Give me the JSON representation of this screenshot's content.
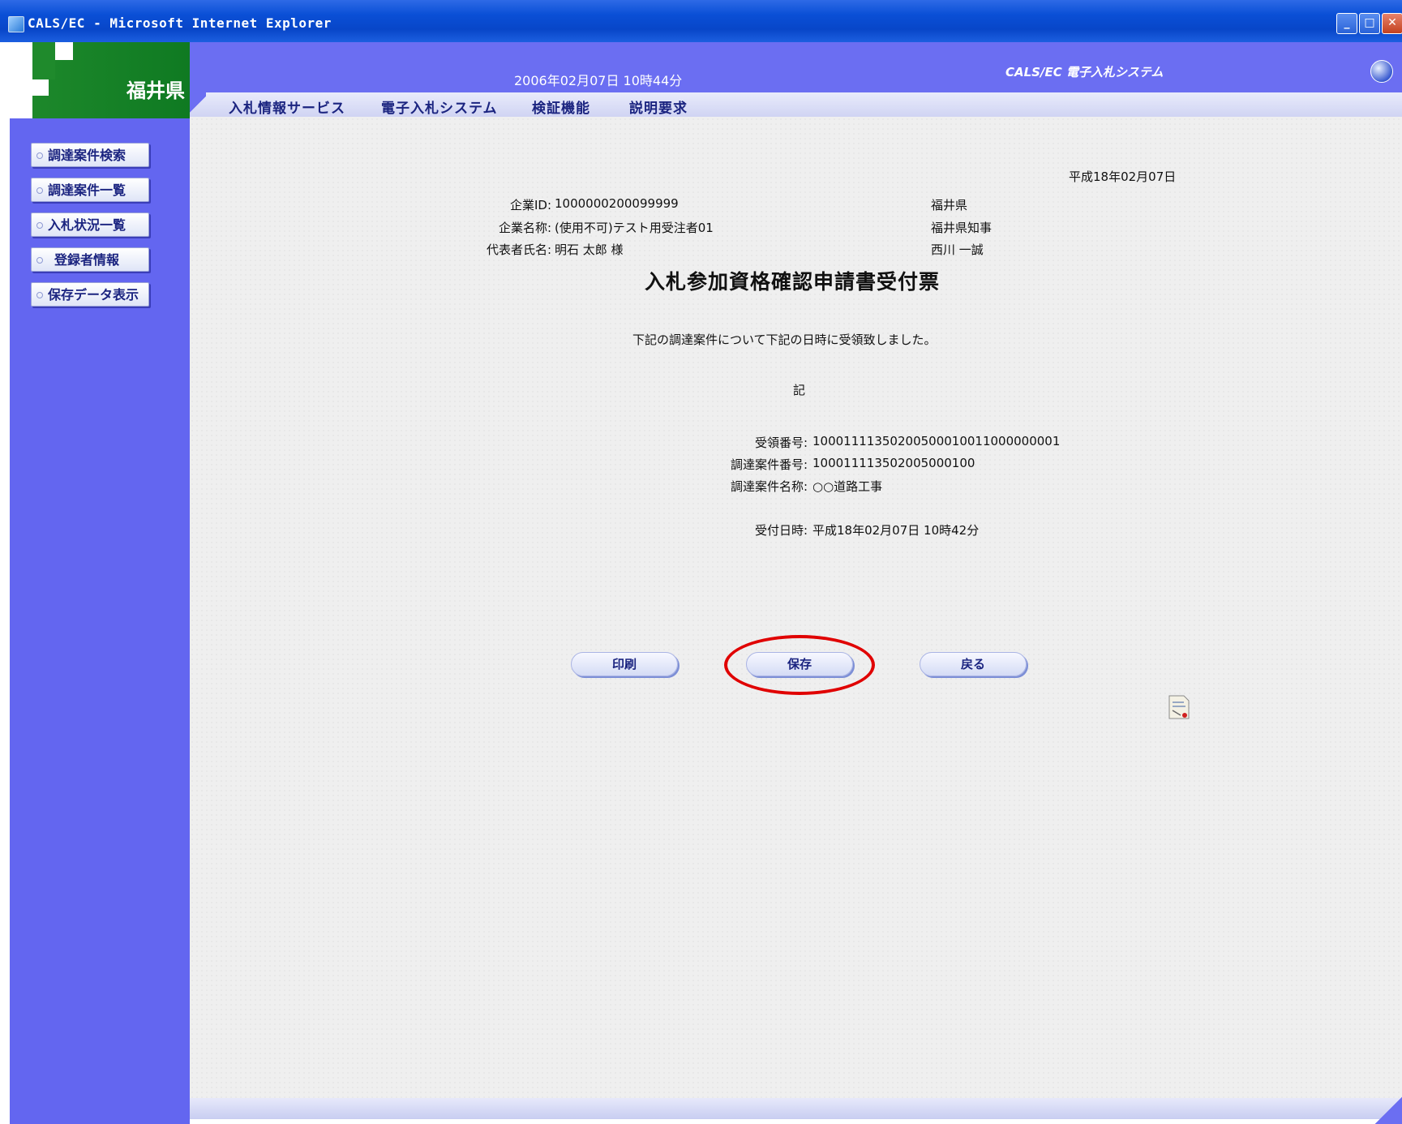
{
  "window": {
    "title": "CALS/EC - Microsoft Internet Explorer",
    "controls": {
      "minimize": "_",
      "maximize": "□",
      "close": "✕"
    }
  },
  "logo": {
    "text": "福井県"
  },
  "header": {
    "datetime": "2006年02月07日 10時44分",
    "system_name": "CALS/EC 電子入札システム"
  },
  "menu": [
    "入札情報サービス",
    "電子入札システム",
    "検証機能",
    "説明要求"
  ],
  "sidebar": {
    "items": [
      "調達案件検索",
      "調達案件一覧",
      "入札状況一覧",
      "登録者情報",
      "保存データ表示"
    ]
  },
  "document": {
    "date": "平成18年02月07日",
    "company_id_label": "企業ID:",
    "company_id": "1000000200099999",
    "company_name_label": "企業名称:",
    "company_name": "(使用不可)テスト用受注者01",
    "rep_name_label": "代表者氏名:",
    "rep_name": "明石 太郎 様",
    "issuer_pref": "福井県",
    "issuer_title": "福井県知事",
    "issuer_name": "西川 一誠",
    "title": "入札参加資格確認申請書受付票",
    "message": "下記の調達案件について下記の日時に受領致しました。",
    "ki": "記",
    "receipt_no_label": "受領番号:",
    "receipt_no": "10001111350200500010011000000001",
    "case_no_label": "調達案件番号:",
    "case_no": "100011113502005000100",
    "case_name_label": "調達案件名称:",
    "case_name": "○○道路工事",
    "received_label": "受付日時:",
    "received": "平成18年02月07日 10時42分"
  },
  "buttons": {
    "print": "印刷",
    "save": "保存",
    "back": "戻る"
  },
  "colors": {
    "sidebar": "#6366f0",
    "header": "#6b6ef2",
    "annotation": "#e00000"
  }
}
